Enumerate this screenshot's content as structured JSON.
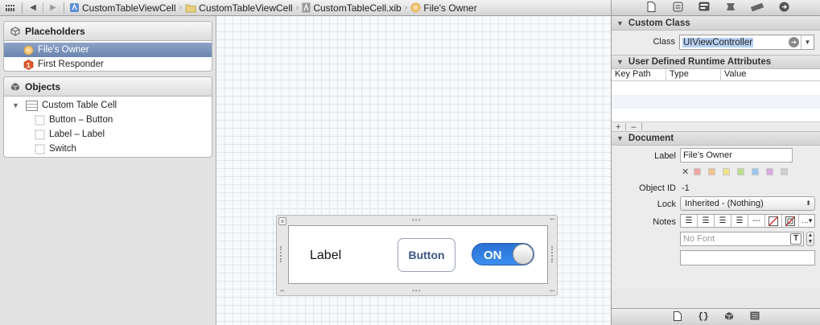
{
  "breadcrumb": [
    "CustomTableViewCell",
    "CustomTableViewCell",
    "CustomTableCell.xib",
    "File's Owner"
  ],
  "outline": {
    "placeholders_title": "Placeholders",
    "files_owner": "File's Owner",
    "first_responder": "First Responder",
    "objects_title": "Objects",
    "cell": "Custom Table Cell",
    "children": [
      "Button – Button",
      "Label – Label",
      "Switch"
    ]
  },
  "cell": {
    "label": "Label",
    "button": "Button",
    "switch_text": "ON"
  },
  "inspector": {
    "custom_class_title": "Custom Class",
    "class_label": "Class",
    "class_value": "UIViewController",
    "runtime_title": "User Defined Runtime Attributes",
    "columns": [
      "Key Path",
      "Type",
      "Value"
    ],
    "add": "+",
    "remove": "–",
    "document_title": "Document",
    "label_label": "Label",
    "label_value": "File's Owner",
    "object_id_label": "Object ID",
    "object_id_value": "-1",
    "lock_label": "Lock",
    "lock_value": "Inherited - (Nothing)",
    "notes_label": "Notes",
    "font_placeholder": "No Font",
    "swatch_colors": [
      "#f2a3a3",
      "#f4c48f",
      "#f1e08a",
      "#b9df8c",
      "#9cc8ee",
      "#dba8e3",
      "#cfcfcf"
    ]
  }
}
